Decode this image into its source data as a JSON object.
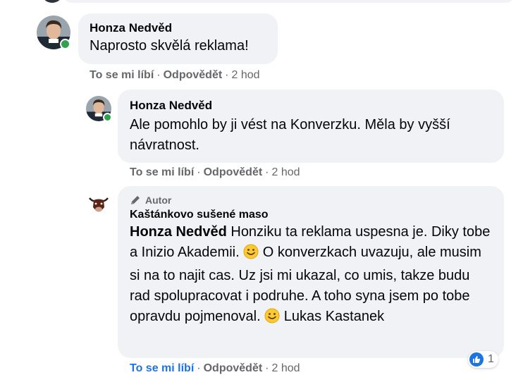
{
  "comments": [
    {
      "author": "Honza Nedvěd",
      "text": "Naprosto skvělá reklama!",
      "actions": {
        "like": "To se mi líbí",
        "reply": "Odpovědět",
        "time": "2 hod",
        "sep": "·"
      }
    },
    {
      "author": "Honza Nedvěd",
      "text": "Ale pomohlo by ji vést na Konverzku. Měla by vyšší návratnost.",
      "actions": {
        "like": "To se mi líbí",
        "reply": "Odpovědět",
        "time": "2 hod",
        "sep": "·"
      }
    },
    {
      "badge": "Autor",
      "author": "Kaštánkovo sušené maso",
      "mention": "Honza Nedvěd",
      "text_parts": [
        " Honziku ta reklama uspesna je. Diky tobe a Inizio Akademii. ",
        " O konverzkach uvazuju, ale musim si na to najit cas. Uz jsi mi ukazal, co umis, takze budu rad spolupracovat i podruhe. A toho syna jsem po tobe opravdu pojmenoval. ",
        " Lukas Kastanek"
      ],
      "emoji": "smiling-face-icon",
      "reactions": {
        "type": "like",
        "count": "1"
      },
      "actions": {
        "like": "To se mi líbí",
        "reply": "Odpovědět",
        "time": "2 hod",
        "sep": "·",
        "liked": true
      }
    }
  ],
  "colors": {
    "bubble": "#f0f2f5",
    "meta_text": "#65676b",
    "link_blue": "#1b74e4",
    "online": "#31a24c"
  }
}
